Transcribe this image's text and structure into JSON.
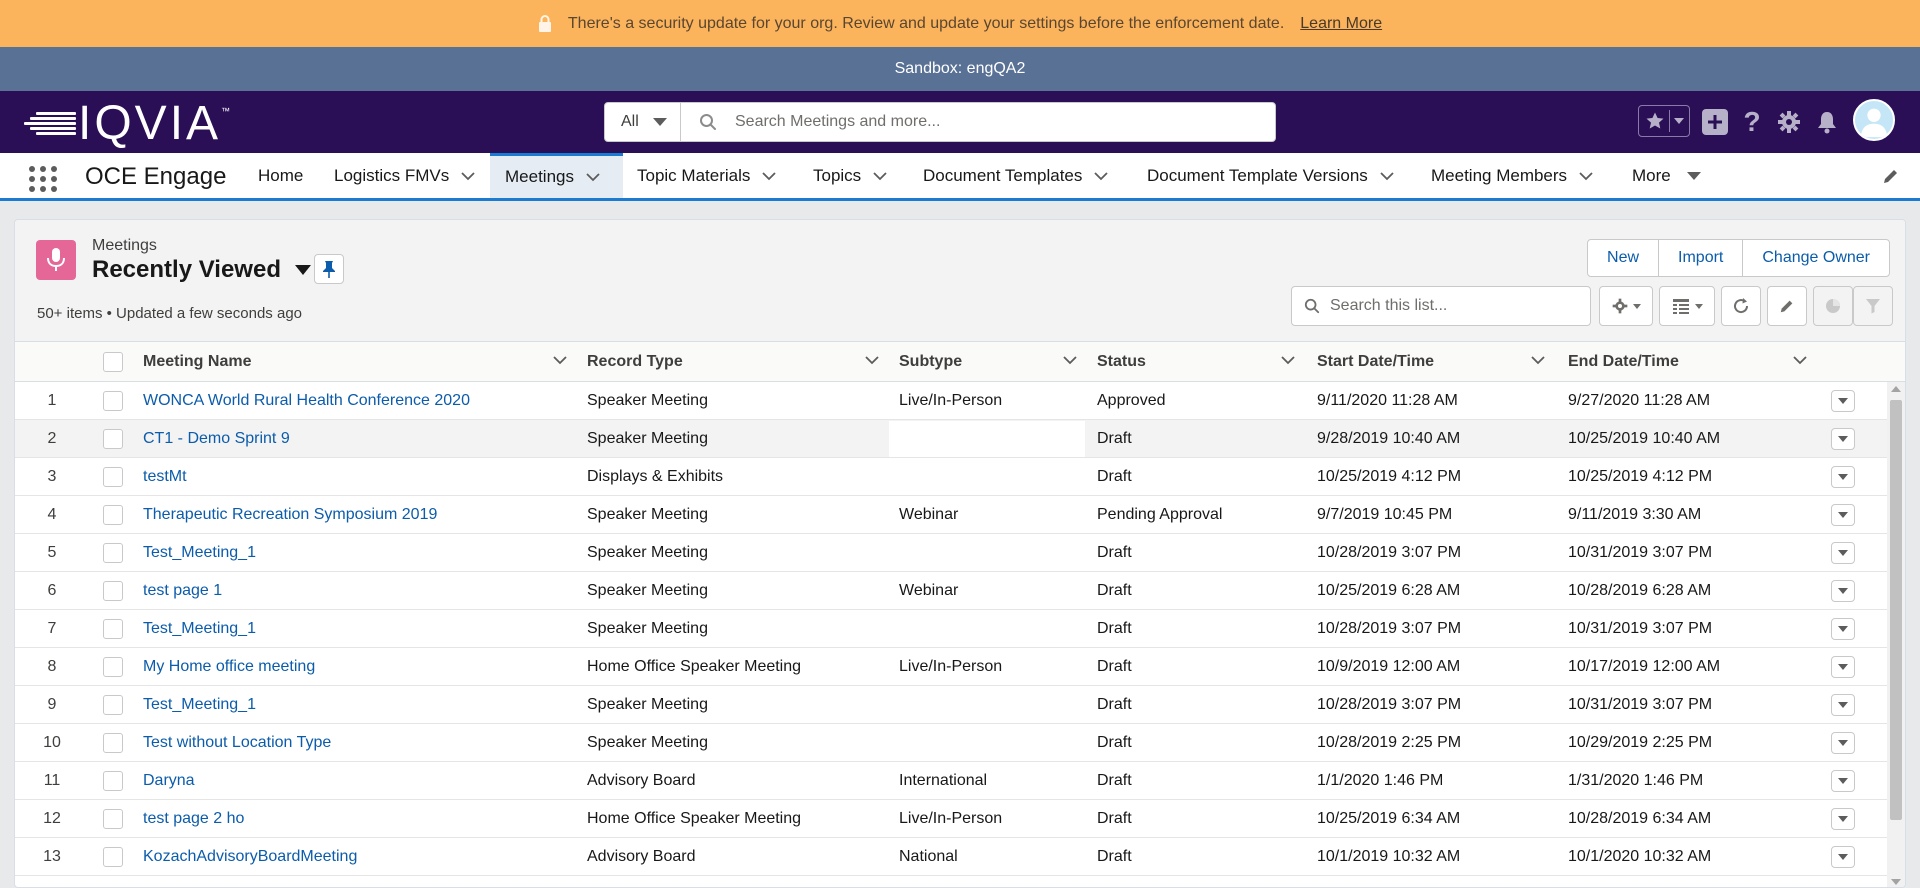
{
  "banner": {
    "message": "There's a security update for your org. Review and update your settings before the enforcement date.",
    "link": "Learn More",
    "icon": "lock-icon"
  },
  "sandbox": {
    "label": "Sandbox: engQA2"
  },
  "header": {
    "logo": "IQVIA",
    "logo_tm": "™",
    "search_scope": "All",
    "search_placeholder": "Search Meetings and more...",
    "icons": [
      "favorites-icon",
      "add-icon",
      "help-icon",
      "setup-gear-icon",
      "notifications-bell-icon",
      "avatar"
    ]
  },
  "nav": {
    "app_name": "OCE Engage",
    "items": [
      {
        "label": "Home",
        "has_menu": false
      },
      {
        "label": "Logistics FMVs",
        "has_menu": true
      },
      {
        "label": "Meetings",
        "has_menu": true,
        "active": true
      },
      {
        "label": "Topic Materials",
        "has_menu": true
      },
      {
        "label": "Topics",
        "has_menu": true
      },
      {
        "label": "Document Templates",
        "has_menu": true
      },
      {
        "label": "Document Template Versions",
        "has_menu": true
      },
      {
        "label": "Meeting Members",
        "has_menu": true
      },
      {
        "label": "More",
        "has_menu": true
      }
    ]
  },
  "list": {
    "object_label": "Meetings",
    "view_name": "Recently Viewed",
    "meta": "50+ items • Updated a few seconds ago",
    "buttons": {
      "new": "New",
      "import": "Import",
      "change_owner": "Change Owner"
    },
    "search_placeholder": "Search this list...",
    "columns": [
      "Meeting Name",
      "Record Type",
      "Subtype",
      "Status",
      "Start Date/Time",
      "End Date/Time"
    ],
    "rows": [
      {
        "num": "1",
        "name": "WONCA World Rural Health Conference 2020",
        "record_type": "Speaker Meeting",
        "subtype": "Live/In-Person",
        "status": "Approved",
        "start": "9/11/2020 11:28 AM",
        "end": "9/27/2020 11:28 AM"
      },
      {
        "num": "2",
        "name": "CT1 - Demo Sprint 9",
        "record_type": "Speaker Meeting",
        "subtype": "",
        "status": "Draft",
        "start": "9/28/2019 10:40 AM",
        "end": "10/25/2019 10:40 AM"
      },
      {
        "num": "3",
        "name": "testMt",
        "record_type": "Displays & Exhibits",
        "subtype": "",
        "status": "Draft",
        "start": "10/25/2019 4:12 PM",
        "end": "10/25/2019 4:12 PM"
      },
      {
        "num": "4",
        "name": "Therapeutic Recreation Symposium 2019",
        "record_type": "Speaker Meeting",
        "subtype": "Webinar",
        "status": "Pending Approval",
        "start": "9/7/2019 10:45 PM",
        "end": "9/11/2019 3:30 AM"
      },
      {
        "num": "5",
        "name": "Test_Meeting_1",
        "record_type": "Speaker Meeting",
        "subtype": "",
        "status": "Draft",
        "start": "10/28/2019 3:07 PM",
        "end": "10/31/2019 3:07 PM"
      },
      {
        "num": "6",
        "name": "test page 1",
        "record_type": "Speaker Meeting",
        "subtype": "Webinar",
        "status": "Draft",
        "start": "10/25/2019 6:28 AM",
        "end": "10/28/2019 6:28 AM"
      },
      {
        "num": "7",
        "name": "Test_Meeting_1",
        "record_type": "Speaker Meeting",
        "subtype": "",
        "status": "Draft",
        "start": "10/28/2019 3:07 PM",
        "end": "10/31/2019 3:07 PM"
      },
      {
        "num": "8",
        "name": "My Home office meeting",
        "record_type": "Home Office Speaker Meeting",
        "subtype": "Live/In-Person",
        "status": "Draft",
        "start": "10/9/2019 12:00 AM",
        "end": "10/17/2019 12:00 AM"
      },
      {
        "num": "9",
        "name": "Test_Meeting_1",
        "record_type": "Speaker Meeting",
        "subtype": "",
        "status": "Draft",
        "start": "10/28/2019 3:07 PM",
        "end": "10/31/2019 3:07 PM"
      },
      {
        "num": "10",
        "name": "Test without Location Type",
        "record_type": "Speaker Meeting",
        "subtype": "",
        "status": "Draft",
        "start": "10/28/2019 2:25 PM",
        "end": "10/29/2019 2:25 PM"
      },
      {
        "num": "11",
        "name": "Daryna",
        "record_type": "Advisory Board",
        "subtype": "International",
        "status": "Draft",
        "start": "1/1/2020 1:46 PM",
        "end": "1/31/2020 1:46 PM"
      },
      {
        "num": "12",
        "name": "test page 2 ho",
        "record_type": "Home Office Speaker Meeting",
        "subtype": "Live/In-Person",
        "status": "Draft",
        "start": "10/25/2019 6:34 AM",
        "end": "10/28/2019 6:34 AM"
      },
      {
        "num": "13",
        "name": "KozachAdvisoryBoardMeeting",
        "record_type": "Advisory Board",
        "subtype": "National",
        "status": "Draft",
        "start": "10/1/2019 10:32 AM",
        "end": "10/1/2020 10:32 AM"
      }
    ]
  },
  "colors": {
    "banner_bg": "#fbb45c",
    "sandbox_bg": "#5a7196",
    "header_bg": "#2a0f56",
    "nav_accent": "#1b7bd1",
    "link": "#0b5cab",
    "object_icon_bg": "#e56798"
  }
}
